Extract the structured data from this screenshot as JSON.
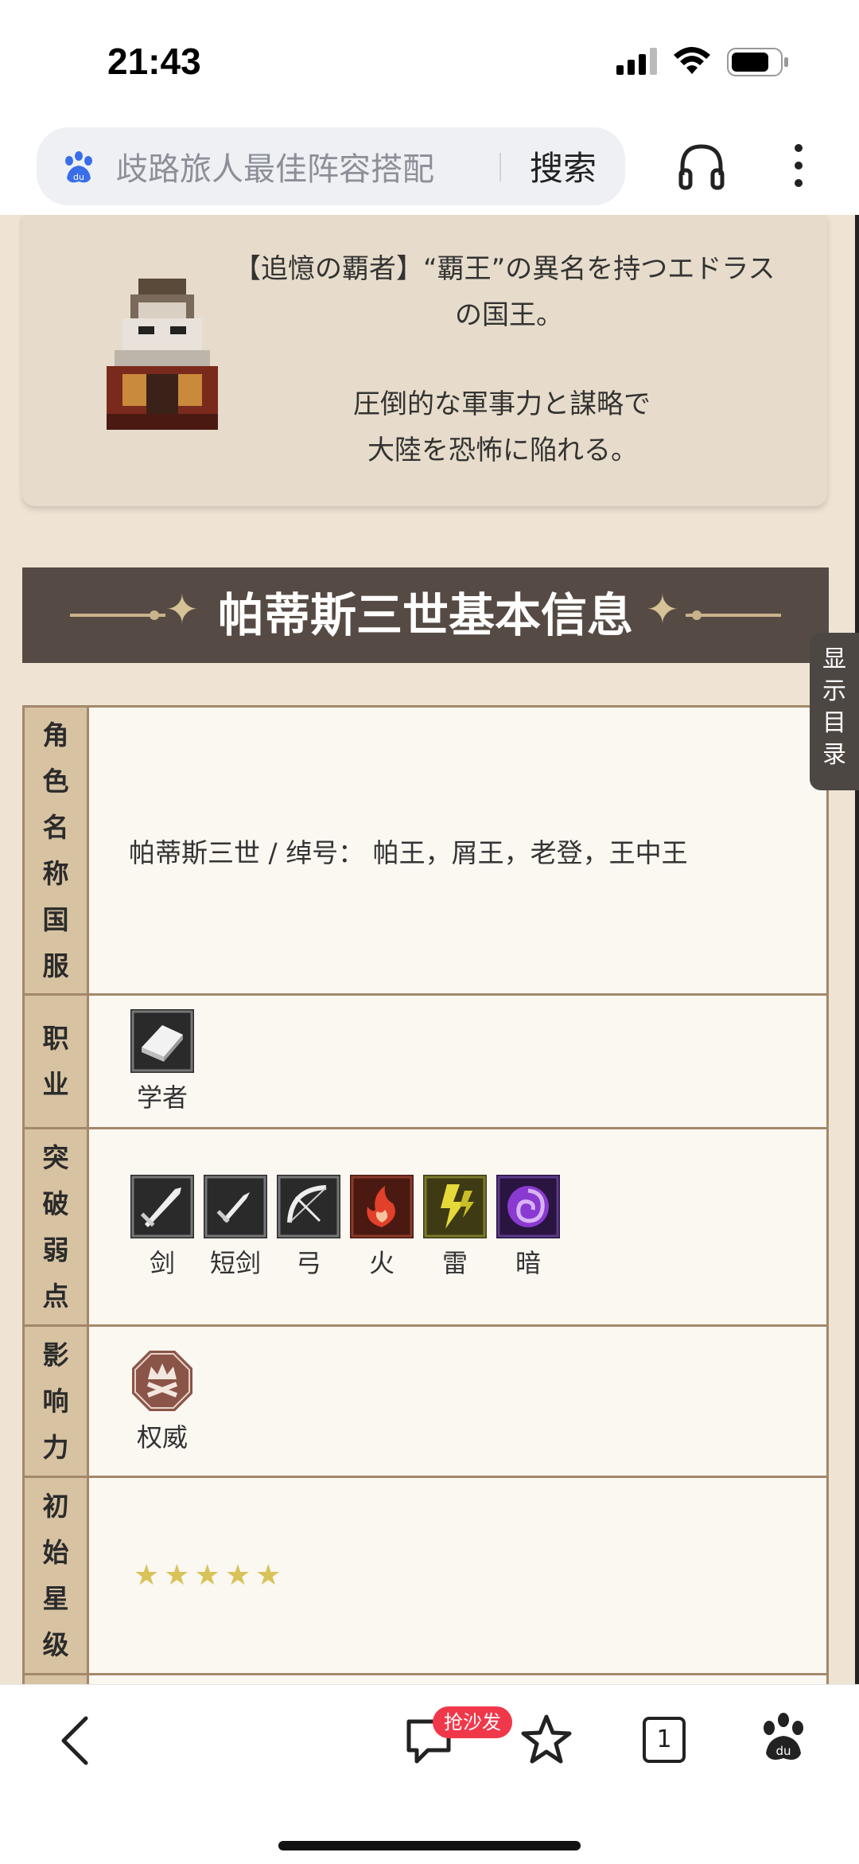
{
  "status_bar": {
    "time": "21:43"
  },
  "search": {
    "query": "歧路旅人最佳阵容搭配",
    "button_label": "搜索"
  },
  "intro": {
    "lines": [
      "【追憶の覇者】“覇王”の異名を持つエドラス",
      "の国王。",
      "圧倒的な軍事力と謀略で",
      "大陸を恐怖に陥れる。"
    ]
  },
  "side_tab": {
    "label": "显示目录"
  },
  "section": {
    "title": "帕蒂斯三世基本信息"
  },
  "info_table": {
    "name_row": {
      "label": "角色名称国服",
      "value": "帕蒂斯三世 / 绰号： 帕王，屑王，老登，王中王"
    },
    "job_row": {
      "label": "职业",
      "job": "学者"
    },
    "weakness_row": {
      "label": "突破弱点",
      "items": [
        "剑",
        "短剑",
        "弓",
        "火",
        "雷",
        "暗"
      ]
    },
    "influence_row": {
      "label": "影响力",
      "value": "权威"
    },
    "rarity_row": {
      "label": "初始星级",
      "stars": "★★★★★"
    }
  },
  "bottom_nav": {
    "comment_badge": "抢沙发",
    "tab_count": "1"
  },
  "icons": {
    "search": "baidu-paw-icon",
    "listen": "headphone-icon",
    "more": "more-vertical-icon",
    "back": "chevron-left-icon",
    "comment": "comment-bubble-icon",
    "favorite": "star-outline-icon",
    "tabs": "tab-count-icon",
    "home": "baidu-paw-icon"
  },
  "colors": {
    "section_bg": "#564b44",
    "label_bg": "#d7c2a2",
    "cell_bg": "#fbf7f1",
    "badge": "#f0384a"
  }
}
